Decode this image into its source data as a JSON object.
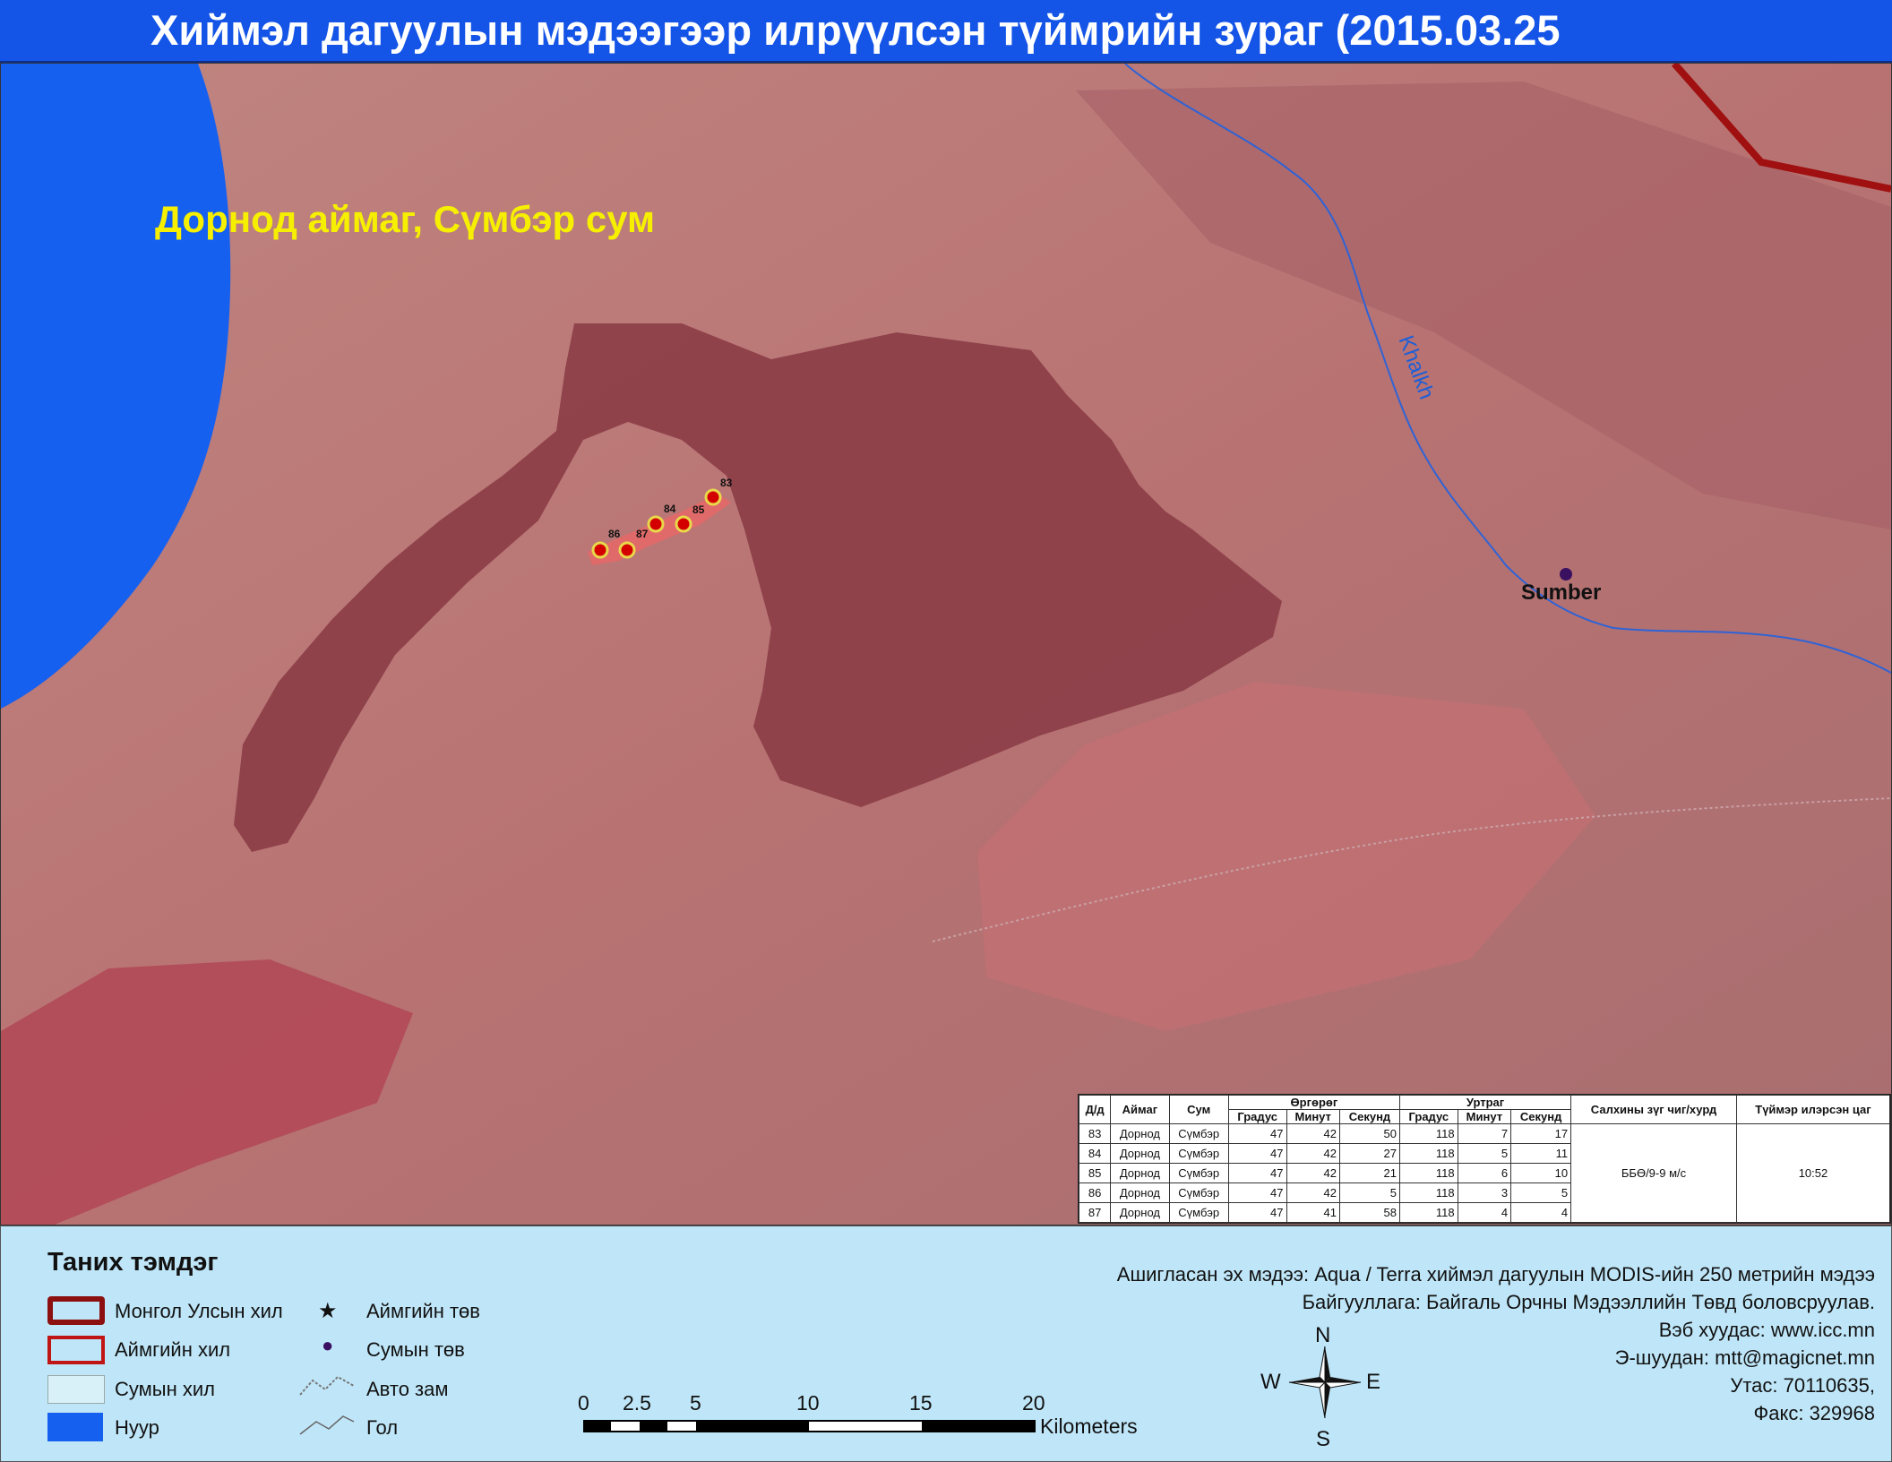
{
  "title": "Хиймэл дагуулын мэдээгээр илрүүлсэн түймрийн зураг  (2015.03.25",
  "map": {
    "region_label": "Дорнод аймаг, Сүмбэр сум",
    "place_label": "Sumber",
    "river_label": "Khalkh",
    "hotspot_labels": [
      "83",
      "84",
      "85",
      "86",
      "87"
    ],
    "colors": {
      "lake": "#1660f0",
      "terrain": "#b97777",
      "burn_scar": "#8c3e48",
      "fresh_fire": "#e06a6a",
      "river": "#2f63d6",
      "province_border": "#a01010"
    }
  },
  "table": {
    "headers": {
      "id": "Д/д",
      "aimag": "Аймаг",
      "sum": "Сум",
      "lat": "Өргөрөг",
      "lon": "Уртраг",
      "deg": "Градус",
      "min": "Минут",
      "sec": "Секунд",
      "wind": "Салхины зүг чиг/хурд",
      "time": "Түймэр илэрсэн цаг"
    },
    "rows": [
      {
        "id": "83",
        "aimag": "Дорнод",
        "sum": "Сүмбэр",
        "lat_d": "47",
        "lat_m": "42",
        "lat_s": "50",
        "lon_d": "118",
        "lon_m": "7",
        "lon_s": "17"
      },
      {
        "id": "84",
        "aimag": "Дорнод",
        "sum": "Сүмбэр",
        "lat_d": "47",
        "lat_m": "42",
        "lat_s": "27",
        "lon_d": "118",
        "lon_m": "5",
        "lon_s": "11"
      },
      {
        "id": "85",
        "aimag": "Дорнод",
        "sum": "Сүмбэр",
        "lat_d": "47",
        "lat_m": "42",
        "lat_s": "21",
        "lon_d": "118",
        "lon_m": "6",
        "lon_s": "10"
      },
      {
        "id": "86",
        "aimag": "Дорнод",
        "sum": "Сүмбэр",
        "lat_d": "47",
        "lat_m": "42",
        "lat_s": "5",
        "lon_d": "118",
        "lon_m": "3",
        "lon_s": "5"
      },
      {
        "id": "87",
        "aimag": "Дорнод",
        "sum": "Сүмбэр",
        "lat_d": "47",
        "lat_m": "41",
        "lat_s": "58",
        "lon_d": "118",
        "lon_m": "4",
        "lon_s": "4"
      }
    ],
    "wind": "ББӨ/9-9 м/с",
    "time": "10:52"
  },
  "legend": {
    "title": "Таних тэмдэг",
    "items": {
      "national_border": "Монгол Улсын хил",
      "province_border": "Аймгийн хил",
      "soum_border": "Сумын хил",
      "lake": "Нуур",
      "province_center": "Аймгийн төв",
      "soum_center": "Сумын төв",
      "road": "Авто зам",
      "river": "Гол"
    }
  },
  "credits": {
    "line1": "Ашигласан эх мэдээ: Aqua / Terra хиймэл дагуулын MODIS-ийн 250 метрийн мэдээ",
    "line2": "Байгууллага: Байгаль Орчны Мэдээллийн Төвд боловсруулав.",
    "line3": "Вэб хуудас: www.icc.mn",
    "line4": "Э-шуудан: mtt@magicnet.mn",
    "line5": "Утас: 70110635,",
    "line6": "Факс: 329968"
  },
  "scale": {
    "ticks": [
      "0",
      "2.5",
      "5",
      "10",
      "15",
      "20"
    ],
    "unit": "Kilometers"
  },
  "compass": {
    "n": "N",
    "s": "S",
    "e": "E",
    "w": "W"
  }
}
